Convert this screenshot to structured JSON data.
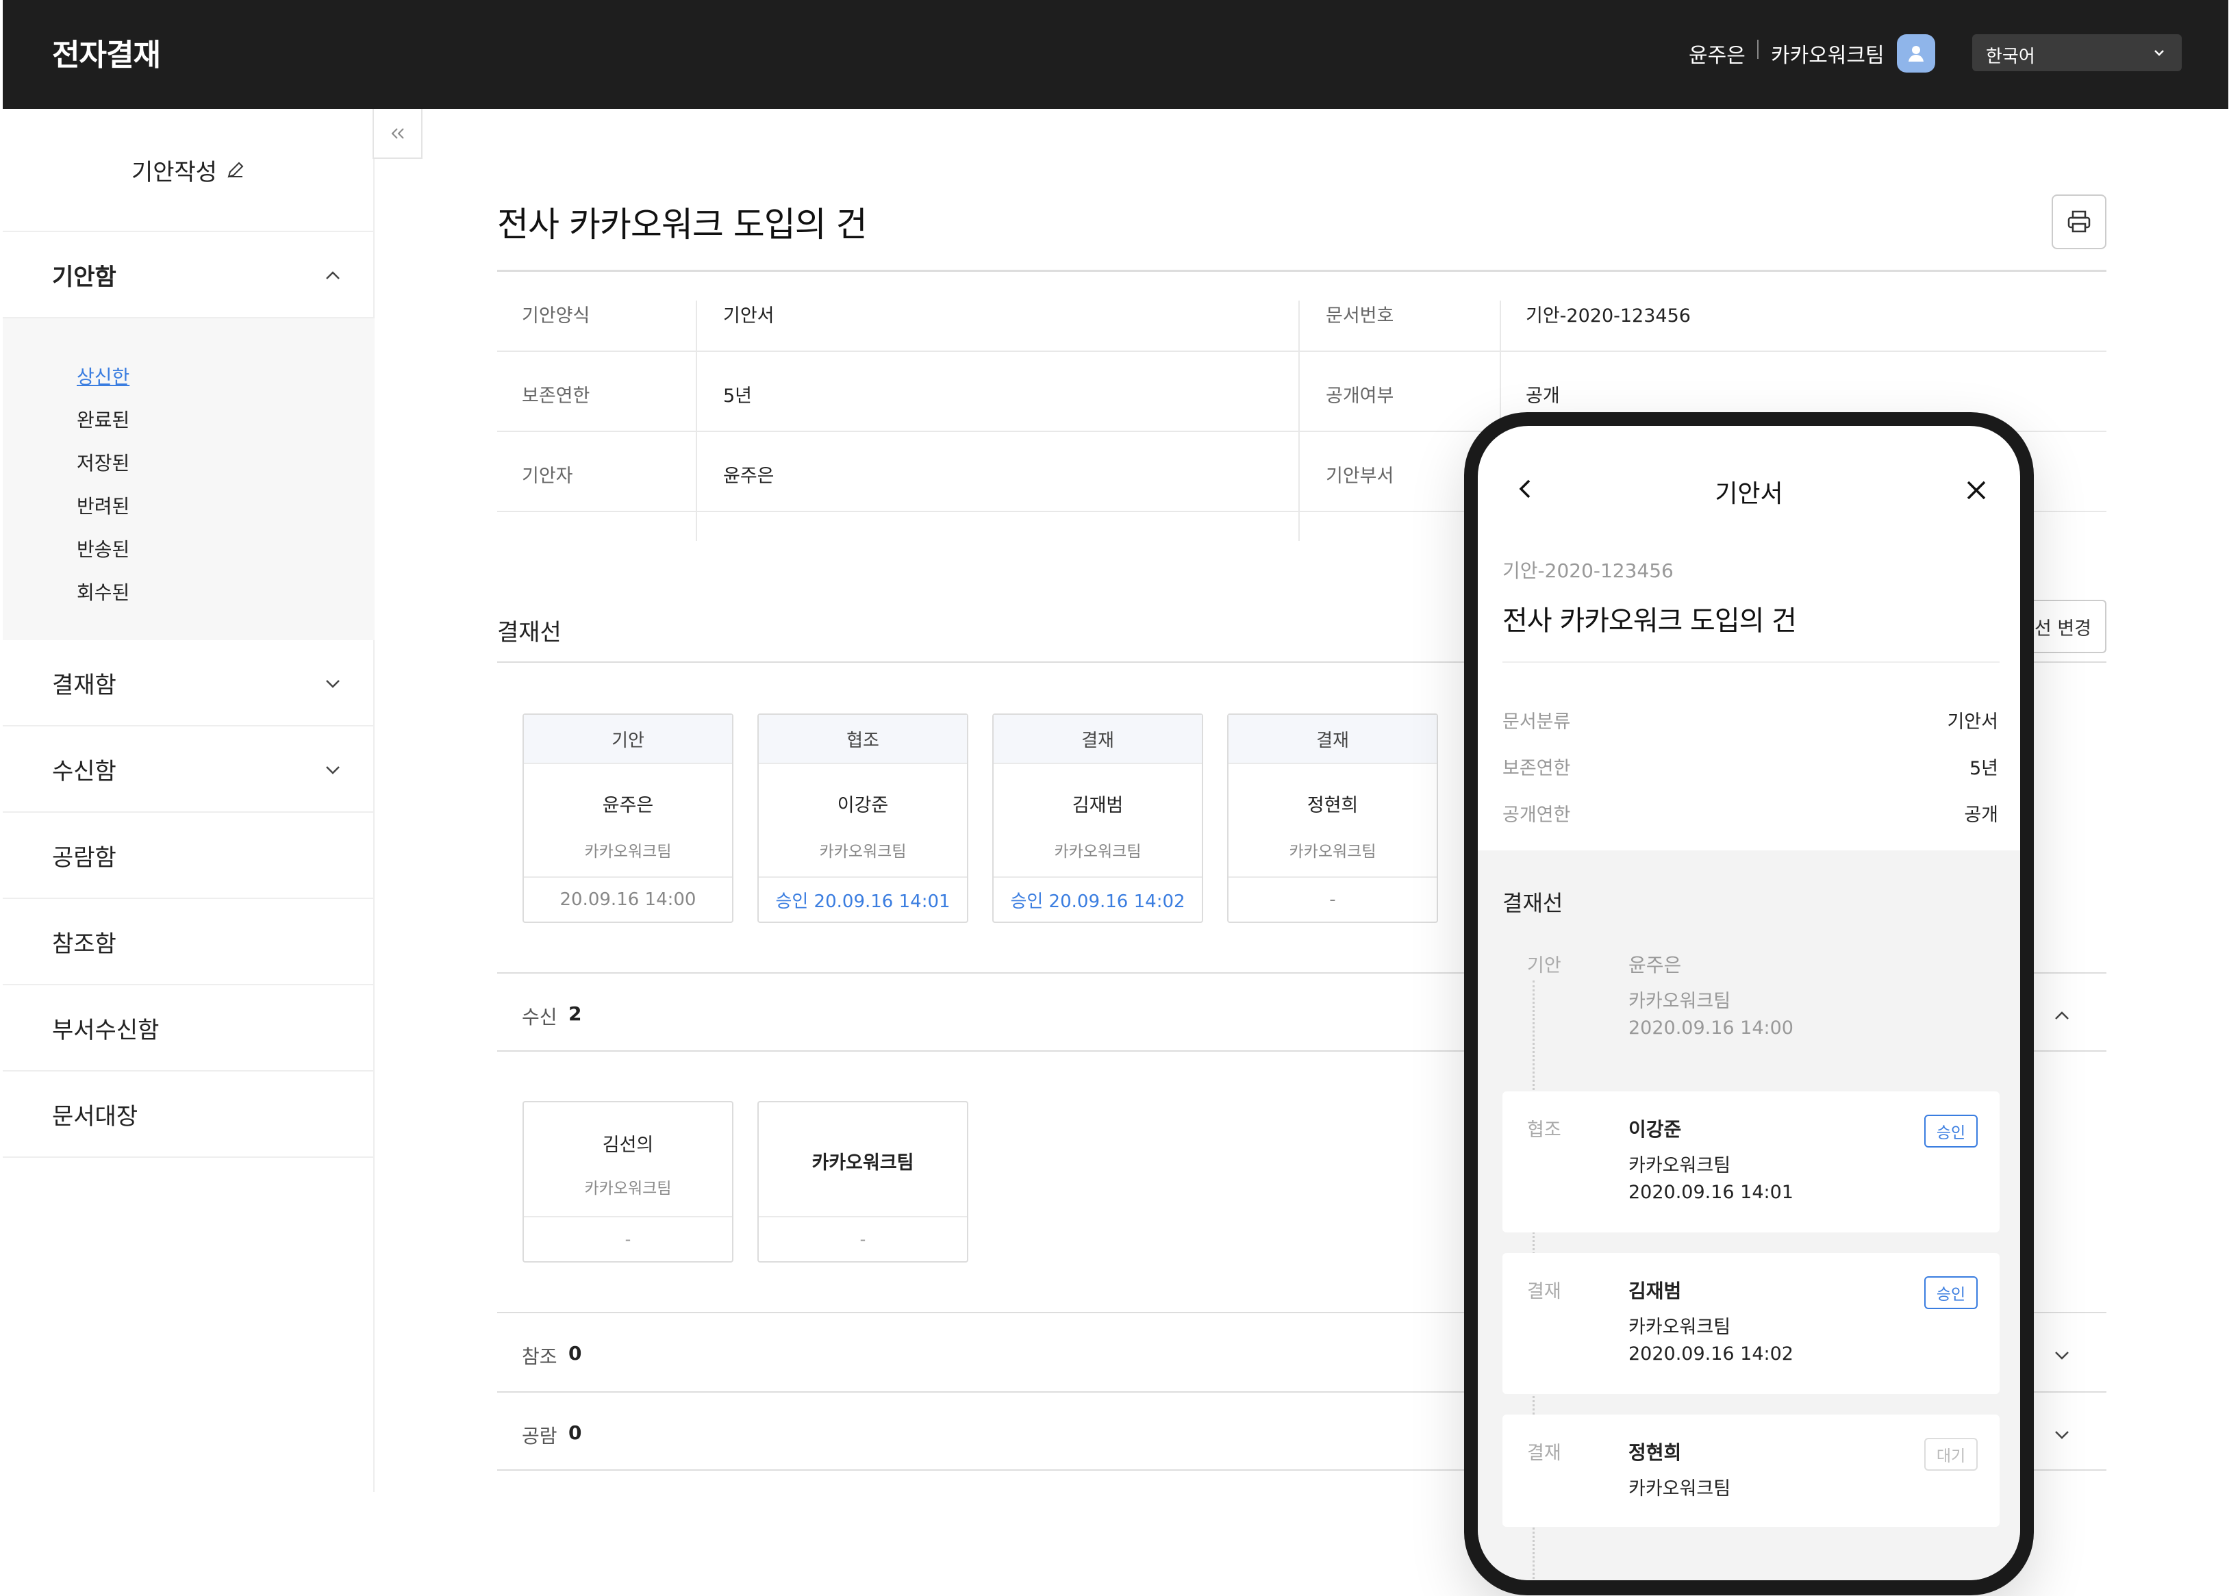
{
  "header": {
    "app_title": "전자결재",
    "user_name": "윤주은",
    "team_name": "카카오워크팀",
    "language": "한국어"
  },
  "sidebar": {
    "draft_label": "기안작성",
    "draftbox": {
      "label": "기안함",
      "items": [
        "상신한",
        "완료된",
        "저장된",
        "반려된",
        "반송된",
        "회수된"
      ]
    },
    "menus": [
      "결재함",
      "수신함",
      "공람함",
      "참조함",
      "부서수신함",
      "문서대장"
    ]
  },
  "document": {
    "title": "전사 카카오워크 도입의 건",
    "info": {
      "form_label": "기안양식",
      "form_value": "기안서",
      "docno_label": "문서번호",
      "docno_value": "기안-2020-123456",
      "retention_label": "보존연한",
      "retention_value": "5년",
      "public_label": "공개여부",
      "public_value": "공개",
      "drafter_label": "기안자",
      "drafter_value": "윤주은",
      "dept_label": "기안부서"
    },
    "approval_line_title": "결재선",
    "change_button": "선 변경",
    "approval_cards": [
      {
        "type": "기안",
        "name": "윤주은",
        "team": "카카오워크팀",
        "footer": "20.09.16 14:00"
      },
      {
        "type": "협조",
        "name": "이강준",
        "team": "카카오워크팀",
        "footer": "승인 20.09.16 14:01"
      },
      {
        "type": "결재",
        "name": "김재범",
        "team": "카카오워크팀",
        "footer": "승인 20.09.16 14:02"
      },
      {
        "type": "결재",
        "name": "정현희",
        "team": "카카오워크팀",
        "footer": "-"
      }
    ],
    "receive": {
      "label": "수신",
      "count": "2"
    },
    "receive_cards": [
      {
        "name": "김선의",
        "team": "카카오워크팀",
        "footer": "-"
      },
      {
        "name": "카카오워크팀",
        "footer": "-"
      }
    ],
    "reference": {
      "label": "참조",
      "count": "0"
    },
    "circulation": {
      "label": "공람",
      "count": "0"
    }
  },
  "mobile": {
    "header_title": "기안서",
    "doc_no": "기안-2020-123456",
    "title": "전사 카카오워크 도입의 건",
    "fields": [
      {
        "label": "문서분류",
        "value": "기안서"
      },
      {
        "label": "보존연한",
        "value": "5년"
      },
      {
        "label": "공개연한",
        "value": "공개"
      }
    ],
    "approval_title": "결재선",
    "steps": [
      {
        "type": "기안",
        "name": "윤주은",
        "team": "카카오워크팀",
        "date": "2020.09.16 14:00"
      },
      {
        "type": "협조",
        "name": "이강준",
        "team": "카카오워크팀",
        "date": "2020.09.16 14:01",
        "badge": "승인"
      },
      {
        "type": "결재",
        "name": "김재범",
        "team": "카카오워크팀",
        "date": "2020.09.16 14:02",
        "badge": "승인"
      },
      {
        "type": "결재",
        "name": "정현희",
        "team": "카카오워크팀",
        "badge": "대기"
      }
    ]
  },
  "colors": {
    "accent": "#3a7de0",
    "topbar": "#1e1e1e"
  }
}
